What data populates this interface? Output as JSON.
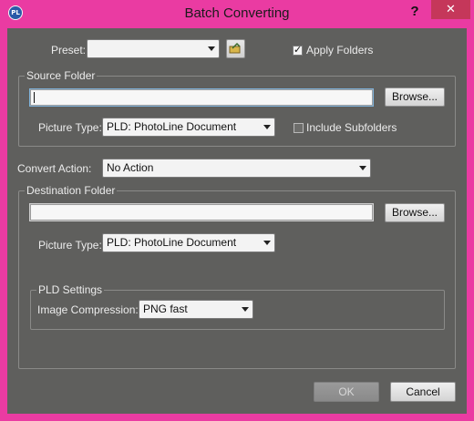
{
  "window": {
    "title": "Batch Converting",
    "help": "?",
    "close": "✕",
    "app_icon": "PL"
  },
  "preset": {
    "label": "Preset:",
    "value": "",
    "button_icon": "load-preset-icon"
  },
  "apply_folders": {
    "label": "Apply Folders",
    "checked": true
  },
  "source": {
    "group_title": "Source Folder",
    "path": "",
    "browse_label": "Browse...",
    "picture_type_label": "Picture Type:",
    "picture_type_value": "PLD: PhotoLine Document",
    "include_subfolders_label": "Include Subfolders",
    "include_subfolders_checked": false
  },
  "convert_action": {
    "label": "Convert Action:",
    "value": "No Action"
  },
  "destination": {
    "group_title": "Destination Folder",
    "path": "",
    "browse_label": "Browse...",
    "picture_type_label": "Picture Type:",
    "picture_type_value": "PLD: PhotoLine Document"
  },
  "pld_settings": {
    "group_title": "PLD Settings",
    "compression_label": "Image Compression:",
    "compression_value": "PNG fast"
  },
  "buttons": {
    "ok": "OK",
    "cancel": "Cancel"
  },
  "colors": {
    "accent": "#ea3ba2",
    "dialog_bg": "#5f5f5d",
    "close_button": "#c5375a"
  }
}
